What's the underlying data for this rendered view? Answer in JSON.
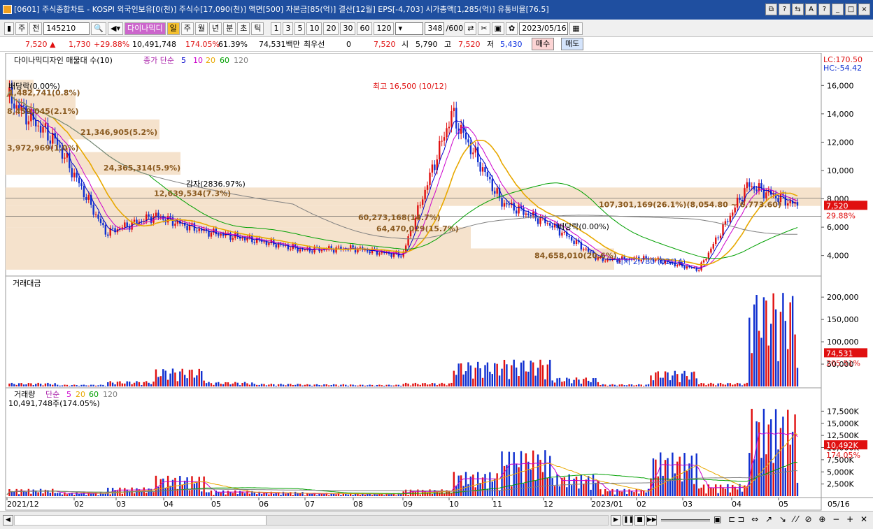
{
  "window": {
    "title": "[0601] 주식종합차트 - KOSPI 외국인보유[0(천)] 주식수[17,090(천)] 액면[500] 자본금[85(억)] 결산[12월] EPS[-4,703] 시가총액[1,285(억)] 유통비율[76.5]",
    "controls": [
      "⧉",
      "?",
      "⇆",
      "A",
      "?",
      "_",
      "□",
      "×"
    ]
  },
  "toolbar": {
    "market": "주",
    "prev": "전",
    "code": "145210",
    "name": "다이나믹디",
    "periods": [
      "일",
      "주",
      "월",
      "년",
      "분",
      "초",
      "틱"
    ],
    "active_period": "일",
    "intervals": [
      "1",
      "3",
      "5",
      "10",
      "20",
      "30",
      "60",
      "120"
    ],
    "count": "348",
    "count_total": "/600",
    "date": "2023/05/16"
  },
  "quote": {
    "price": "7,520",
    "change": "1,730",
    "change_pct": "+29.88%",
    "volume": "10,491,748",
    "vol_ratio": "174.05%",
    "turnover": "61.39%",
    "amount": "74,531백만",
    "pref_label": "최우선",
    "pref_value": "0",
    "ask": "7,520",
    "open_label": "시",
    "open": "5,790",
    "high_label": "고",
    "high": "7,520",
    "low_label": "저",
    "low": "5,430",
    "buy_label": "매수",
    "sell_label": "매도"
  },
  "price_panel": {
    "legend_name": "다이나믹디자인 매물대 수(10)",
    "legend_ma": "종가 단순",
    "ma_periods": [
      "5",
      "10",
      "20",
      "60",
      "120"
    ],
    "ma_colors": [
      "#0000cc",
      "#cc00cc",
      "#e8a800",
      "#00a000",
      "#808080"
    ],
    "lc": "LC:170.50",
    "hc": "HC:-54.42",
    "y_ticks": [
      "16,000",
      "14,000",
      "12,000",
      "10,000",
      "8,000",
      "6,000",
      "4,000"
    ],
    "last_label": "7,520",
    "last_pct": "29.88%",
    "annot_high": "최고 16,500 (10/12)",
    "annot_low": "최저 2,780 (03/14)",
    "annot_ratio1": "배당락(0.00%)",
    "annot_ratio2": "배당락(0.00%)",
    "annot_ratio3": "감자(2836.97%)",
    "volume_profile_labels": [
      "1,482,741(0.8%)",
      "8,459,045(2.1%)",
      "21,346,905(5.2%)",
      "3,972,969(1.0%)",
      "24,365,314(5.9%)",
      "12,639,534(7.3%)",
      "107,301,169(26.1%)(8,054.80 ~ 6,773.60)",
      "60,273,168(14.7%)",
      "64,470,029(15.7%)",
      "84,658,010(20.6%)"
    ]
  },
  "amount_panel": {
    "title": "거래대금",
    "y_ticks": [
      "200,000",
      "150,000",
      "100,000",
      "50,000"
    ],
    "last_label": "74,531",
    "last_pct": "205.51%"
  },
  "volume_panel": {
    "title": "거래량",
    "legend_ma": "단순",
    "ma_periods": [
      "5",
      "20",
      "60",
      "120"
    ],
    "subtitle": "10,491,748주(174.05%)",
    "y_ticks": [
      "17,500K",
      "15,000K",
      "12,500K",
      "10,000K",
      "7,500K",
      "5,000K",
      "2,500K"
    ],
    "last_label": "10,492K",
    "last_pct": "174.05%"
  },
  "x_axis": [
    "2021/12",
    "02",
    "03",
    "04",
    "05",
    "06",
    "07",
    "08",
    "09",
    "10",
    "11",
    "12",
    "2023/01",
    "02",
    "03",
    "04",
    "05"
  ],
  "x_end": "05/16",
  "colors": {
    "up": "#e01010",
    "down": "#1030d0",
    "profile": "#f5e2cc",
    "title": "#1f4fa0"
  },
  "chart_data": {
    "type": "candlestick",
    "series": [
      {
        "name": "종가 단순 5",
        "x": [
          "2021/12",
          "02",
          "03",
          "04",
          "05",
          "06",
          "07",
          "08",
          "09",
          "10",
          "11",
          "12",
          "2023/01",
          "02",
          "03",
          "04",
          "05"
        ],
        "values": [
          15000,
          12500,
          5800,
          6600,
          5800,
          5200,
          4400,
          4400,
          4100,
          15500,
          8000,
          6500,
          3600,
          3800,
          3000,
          9500,
          6000
        ]
      },
      {
        "name": "종가 단순 120",
        "x": [
          "2021/12",
          "02",
          "03",
          "04",
          "05",
          "06",
          "07",
          "08",
          "09",
          "10",
          "11",
          "12",
          "2023/01",
          "02",
          "03",
          "04",
          "05"
        ],
        "values": [
          15500,
          14200,
          12000,
          10500,
          9000,
          8000,
          7300,
          6800,
          6400,
          6300,
          6500,
          6300,
          5800,
          5500,
          5200,
          5000,
          5100
        ]
      }
    ],
    "close": [
      15200,
      12000,
      5600,
      6800,
      5700,
      5100,
      4400,
      4500,
      4000,
      14000,
      7800,
      6200,
      3700,
      3800,
      3000,
      9000,
      7520
    ],
    "ylim": [
      2700,
      17200
    ],
    "amount_values": [
      8000,
      4000,
      12000,
      40000,
      10000,
      6000,
      5000,
      4000,
      8000,
      55000,
      60000,
      20000,
      5000,
      35000,
      8000,
      210000,
      74531
    ],
    "volume_values": [
      1500,
      800,
      1800,
      4200,
      1200,
      900,
      700,
      650,
      1400,
      5000,
      9500,
      4500,
      1500,
      9000,
      2500,
      18000,
      10492
    ]
  }
}
